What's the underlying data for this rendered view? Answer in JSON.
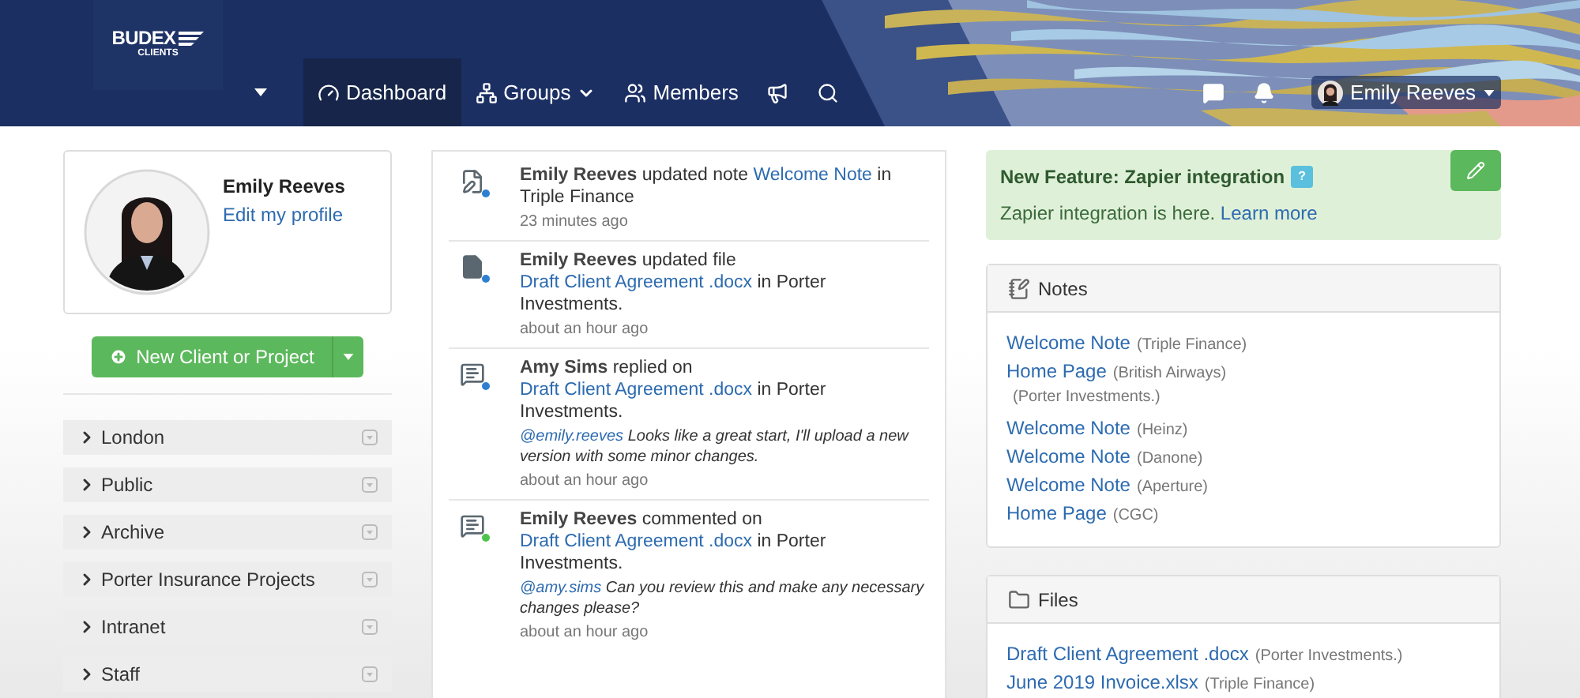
{
  "header": {
    "logo": {
      "name": "BUDEX",
      "sub": "CLIENTS"
    },
    "nav": [
      {
        "kind": "dashboard",
        "label": "Dashboard",
        "selected": true
      },
      {
        "kind": "groups",
        "label": "Groups",
        "selected": false
      },
      {
        "kind": "members",
        "label": "Members",
        "selected": false
      },
      {
        "kind": "announce",
        "selected": false
      },
      {
        "kind": "search",
        "selected": false
      }
    ],
    "user": {
      "name": "Emily Reeves"
    }
  },
  "profile": {
    "name": "Emily Reeves",
    "edit_link": "Edit my profile"
  },
  "new_button": {
    "label": "New Client or Project"
  },
  "groups": [
    {
      "label": "London"
    },
    {
      "label": "Public"
    },
    {
      "label": "Archive"
    },
    {
      "label": "Porter Insurance Projects"
    },
    {
      "label": "Intranet"
    },
    {
      "label": "Staff"
    }
  ],
  "activity": [
    {
      "kind": "note",
      "color": "#2f7fd1",
      "actor": "Emily Reeves",
      "action": "updated note",
      "link": "Welcome Note",
      "rest": "in Triple Finance",
      "time": "23 minutes ago"
    },
    {
      "kind": "file",
      "color": "#2f7fd1",
      "actor": "Emily Reeves",
      "action": "updated file",
      "link": "Draft Client Agreement .docx",
      "rest": "in Porter Investments.",
      "time": "about an hour ago"
    },
    {
      "kind": "reply",
      "color": "#2f7fd1",
      "actor": "Amy Sims",
      "action": "replied on",
      "link": "Draft Client Agreement .docx",
      "rest": "in Porter Investments.",
      "mention": "@emily.reeves",
      "comment": "Looks like a great start, I'll upload a new version with some minor changes.",
      "time": "about an hour ago"
    },
    {
      "kind": "comment",
      "color": "#4cc44c",
      "actor": "Emily Reeves",
      "action": "commented on",
      "link": "Draft Client Agreement .docx",
      "rest": "in Porter Investments.",
      "mention": "@amy.sims",
      "comment": "Can you review this and make any necessary changes please?",
      "time": "about an hour ago"
    }
  ],
  "feature": {
    "title": "New Feature: Zapier integration",
    "help": "?",
    "text": "Zapier integration is here.",
    "link": "Learn more"
  },
  "notes": {
    "title": "Notes",
    "items": [
      {
        "title": "Welcome Note",
        "context": "(Triple Finance)"
      },
      {
        "title": "Home Page",
        "context": "(British Airways)"
      },
      {
        "context": "(Porter Investments.)"
      },
      {
        "title": "Welcome Note",
        "context": "(Heinz)"
      },
      {
        "title": "Welcome Note",
        "context": "(Danone)"
      },
      {
        "title": "Welcome Note",
        "context": "(Aperture)"
      },
      {
        "title": "Home Page",
        "context": "(CGC)"
      }
    ]
  },
  "files": {
    "title": "Files",
    "items": [
      {
        "title": "Draft Client Agreement .docx",
        "context": "(Porter Investments.)"
      },
      {
        "title": "June 2019 Invoice.xlsx",
        "context": "(Triple Finance)"
      }
    ]
  }
}
